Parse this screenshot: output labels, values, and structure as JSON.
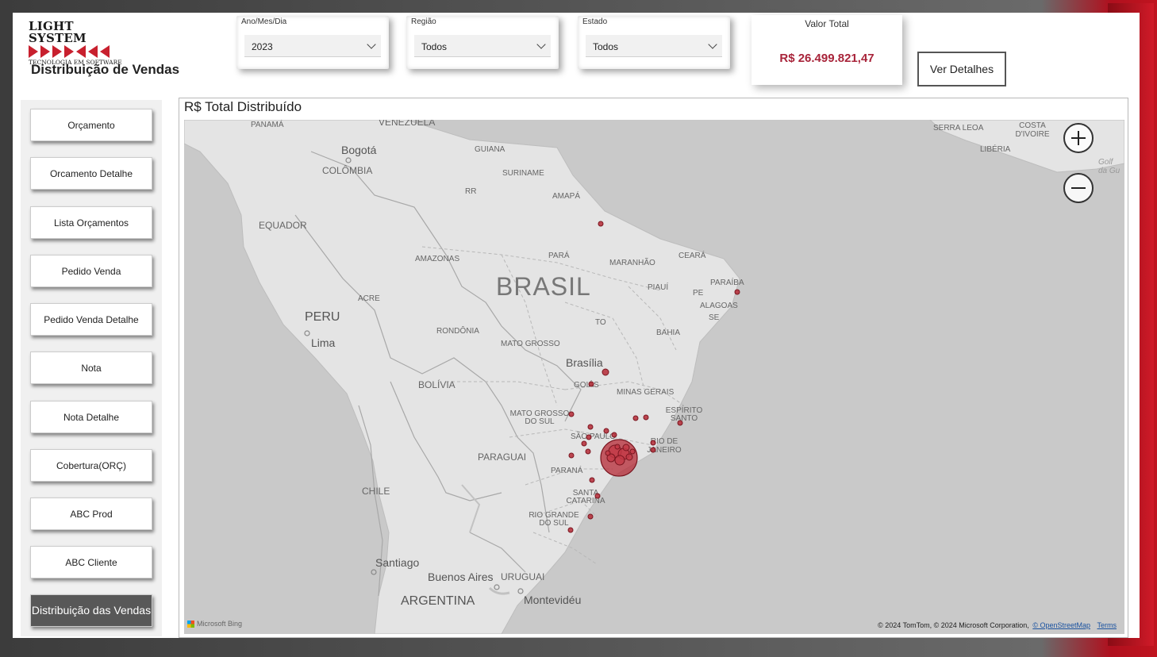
{
  "header": {
    "logo_line1": "LIGHT SYSTEM",
    "logo_line2": "TECNOLOGIA EM SOFTWARE",
    "page_title": "Distribuição de Vendas"
  },
  "filters": [
    {
      "label": "Ano/Mes/Dia",
      "value": "2023"
    },
    {
      "label": "Região",
      "value": "Todos"
    },
    {
      "label": "Estado",
      "value": "Todos"
    }
  ],
  "kpi": {
    "label": "Valor Total",
    "value": "R$ 26.499.821,47",
    "color": "#a8243a"
  },
  "detail_button": "Ver Detalhes",
  "nav": {
    "items": [
      {
        "label": "Orçamento"
      },
      {
        "label": "Orcamento Detalhe"
      },
      {
        "label": "Lista Orçamentos"
      },
      {
        "label": "Pedido Venda"
      },
      {
        "label": "Pedido Venda Detalhe"
      },
      {
        "label": "Nota"
      },
      {
        "label": "Nota Detalhe"
      },
      {
        "label": "Cobertura(ORÇ)"
      },
      {
        "label": "ABC Prod"
      },
      {
        "label": "ABC Cliente"
      },
      {
        "label": "Distribuição das Vendas",
        "active": true
      }
    ]
  },
  "map": {
    "title": "R$ Total Distribuído",
    "bubble_color": "#b52a36",
    "labels": {
      "panama": "PANAMÁ",
      "venezuela": "VENEZUELA",
      "bogota": "Bogotá",
      "colombia": "COLÔMBIA",
      "guiana": "GUIANA",
      "suriname": "SURINAME",
      "rr": "RR",
      "amapa": "AMAPÁ",
      "equador": "EQUADOR",
      "amazonas": "AMAZONAS",
      "para": "PARÁ",
      "maranhao": "MARANHÃO",
      "ceara": "CEARÁ",
      "brasil": "BRASIL",
      "piaui": "PIAUÍ",
      "paraiba": "PARAÍBA",
      "pe": "PE",
      "alagoas": "ALAGOAS",
      "se": "SE",
      "acre": "ACRE",
      "peru": "PERU",
      "lima": "Lima",
      "rondonia": "RONDÔNIA",
      "to": "TO",
      "bahia": "BAHIA",
      "mato_grosso": "MATO GROSSO",
      "brasilia": "Brasília",
      "goias": "GOIÁS",
      "minas": "MINAS GERAIS",
      "bolivia": "BOLÍVIA",
      "ms": "MATO GROSSO DO SUL",
      "espirito_santo": "ESPÍRITO SANTO",
      "sao_paulo": "SÃO PAULO",
      "rio": "RIO DE JANEIRO",
      "paraguai": "PARAGUAI",
      "parana": "PARANÁ",
      "santa_catarina": "SANTA CATARINA",
      "chile": "CHILE",
      "rio_grande": "RIO GRANDE DO SUL",
      "santiago": "Santiago",
      "buenos_aires": "Buenos Aires",
      "uruguai": "URUGUAI",
      "argentina": "ARGENTINA",
      "montevideu": "Montevidéu",
      "serra_leoa": "SERRA LEOA",
      "costa_marfim": "COSTA D'IVOIRE",
      "liberia": "LIBÉRIA",
      "golfo": "Golf da Gu"
    },
    "attribution": "© 2024 TomTom, © 2024 Microsoft Corporation,",
    "osm": "© OpenStreetMap",
    "terms": "Terms",
    "bing": "Microsoft Bing"
  }
}
